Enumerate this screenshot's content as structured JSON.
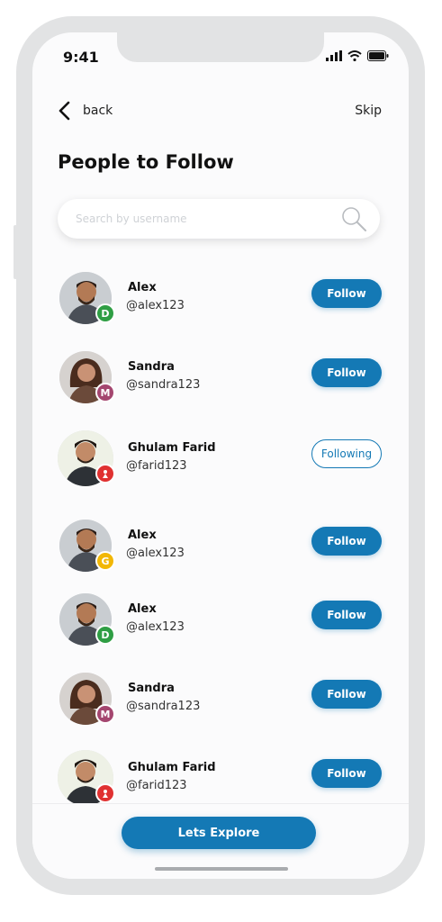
{
  "status_bar": {
    "time": "9:41"
  },
  "nav": {
    "back_label": "back",
    "skip_label": "Skip"
  },
  "page": {
    "title": "People to Follow"
  },
  "search": {
    "placeholder": "Search by username",
    "value": ""
  },
  "users": [
    {
      "name": "Alex",
      "handle": "@alex123",
      "badge": "D",
      "badge_color": "#2f9e44",
      "action": "Follow",
      "following": false
    },
    {
      "name": "Sandra",
      "handle": "@sandra123",
      "badge": "M",
      "badge_color": "#a4466f",
      "action": "Follow",
      "following": false
    },
    {
      "name": "Ghulam Farid",
      "handle": "@farid123",
      "badge": "",
      "badge_color": "#e03131",
      "action": "Following",
      "following": true
    },
    {
      "name": "Alex",
      "handle": "@alex123",
      "badge": "G",
      "badge_color": "#f2b705",
      "action": "Follow",
      "following": false
    },
    {
      "name": "Alex",
      "handle": "@alex123",
      "badge": "D",
      "badge_color": "#2f9e44",
      "action": "Follow",
      "following": false
    },
    {
      "name": "Sandra",
      "handle": "@sandra123",
      "badge": "M",
      "badge_color": "#a4466f",
      "action": "Follow",
      "following": false
    },
    {
      "name": "Ghulam Farid",
      "handle": "@farid123",
      "badge": "",
      "badge_color": "#e03131",
      "action": "Follow",
      "following": false
    }
  ],
  "cta": {
    "label": "Lets Explore"
  },
  "colors": {
    "accent": "#1479b5"
  },
  "icons": {
    "back": "chevron-left-icon",
    "search": "search-icon"
  }
}
